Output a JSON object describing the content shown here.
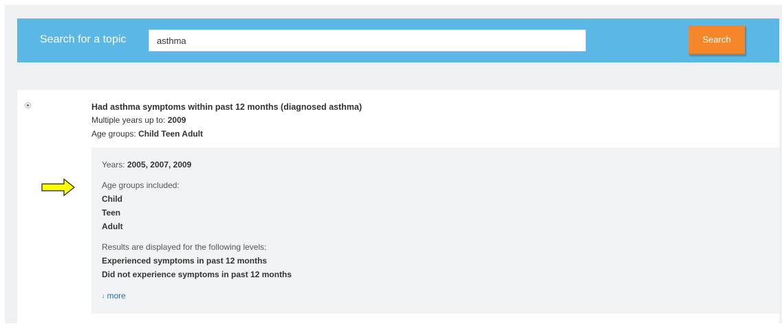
{
  "search": {
    "label": "Search for a topic",
    "value": "asthma",
    "button_label": "Search"
  },
  "result": {
    "title": "Had asthma symptoms within past 12 months (diagnosed asthma)",
    "years_prefix": "Multiple years up to:",
    "years_value": "2009",
    "age_prefix": "Age groups:",
    "age_value": "Child Teen Adult",
    "selected": true,
    "details": {
      "years_label": "Years:",
      "years_value": "2005, 2007, 2009",
      "age_groups_label": "Age groups included:",
      "age_groups": [
        "Child",
        "Teen",
        "Adult"
      ],
      "levels_label": "Results are displayed for the following levels:",
      "levels": [
        "Experienced symptoms in past 12 months",
        "Did not experience symptoms in past 12 months"
      ],
      "more_label": "more"
    }
  },
  "colors": {
    "search_bar": "#5bb8e6",
    "search_button": "#f5872a",
    "panel_background": "#eef0f2",
    "detail_background": "#f2f3f4",
    "link": "#2a6bb3",
    "annotation_arrow": "#ffff00"
  },
  "icons": {
    "radio": "radio-selected-icon",
    "more": "double-chevron-down-icon",
    "annotation": "right-arrow-icon"
  }
}
